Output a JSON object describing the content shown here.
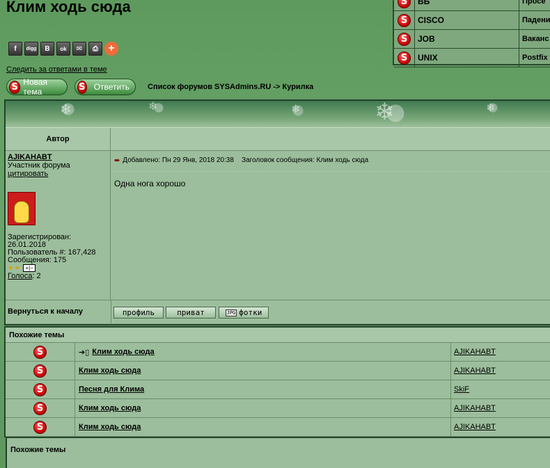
{
  "page": {
    "title": "Клим ходь сюда"
  },
  "share": {
    "buttons": [
      {
        "icon": "facebook-icon",
        "glyph": "f"
      },
      {
        "icon": "digg-icon",
        "glyph": "digg"
      },
      {
        "icon": "vkontakte-icon",
        "glyph": "B"
      },
      {
        "icon": "odnoklassniki-icon",
        "glyph": "ok"
      },
      {
        "icon": "email-icon",
        "glyph": "✉"
      },
      {
        "icon": "print-icon",
        "glyph": "⎙"
      },
      {
        "icon": "more-share-icon",
        "glyph": "+"
      }
    ]
  },
  "follow_link": "Следить за ответами в теме",
  "sidebar": {
    "rows": [
      {
        "name": "ВБ",
        "desc": "Просе"
      },
      {
        "name": "CISCO",
        "desc": "Падени"
      },
      {
        "name": "JOB",
        "desc": "Ваканс"
      },
      {
        "name": "UNIX",
        "desc": "Postfix"
      }
    ]
  },
  "actions": {
    "new_topic": "Новая тема",
    "reply": "Ответить"
  },
  "breadcrumb": "Список форумов SYSAdmins.RU -> Курилка",
  "post": {
    "header_author": "Автор",
    "author": {
      "name": "AJIKAHABT",
      "rank": "Участник форума",
      "quote": "цитировать",
      "registered": "Зарегистрирован: 26.01.2018",
      "user_no": "Пользователь #: 167,428",
      "messages": "Сообщения: 175",
      "votes_label": "Голоса",
      "votes_value": ": 2"
    },
    "meta": "Добавлено: Пн 29 Янв, 2018 20:38    Заголовок сообщения: Клим ходь сюда",
    "body": "Одна нога хорошо",
    "back_to_top": "Вернуться к началу",
    "buttons": {
      "profile": "профиль",
      "private": "приват",
      "photos": "фотки"
    }
  },
  "similar": {
    "heading": "Похожие темы",
    "rows": [
      {
        "title": "Клим ходь сюда",
        "author": "AJIKAHABT",
        "current": true
      },
      {
        "title": "Клим ходь сюда",
        "author": "AJIKAHABT",
        "current": false
      },
      {
        "title": "Песня для Клима",
        "author": "SkiF",
        "current": false
      },
      {
        "title": "Клим ходь сюда",
        "author": "AJIKAHABT",
        "current": false
      },
      {
        "title": "Клим ходь сюда",
        "author": "AJIKAHABT",
        "current": false
      }
    ]
  },
  "similar2": {
    "heading": "Похожие темы"
  }
}
